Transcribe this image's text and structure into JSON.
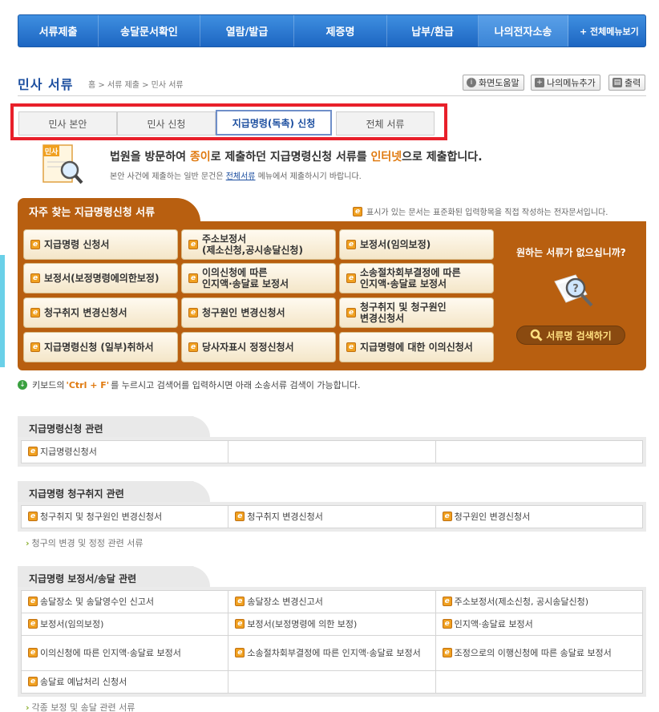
{
  "nav": {
    "items": [
      "서류제출",
      "송달문서확인",
      "열람/발급",
      "제증명",
      "납부/환급",
      "나의전자소송"
    ],
    "active": "나의전자소송",
    "all_menu": "+ 전체메뉴보기"
  },
  "header": {
    "title": "민사 서류",
    "breadcrumb": "홈 > 서류 제출 > 민사 서류",
    "help": "화면도움말",
    "add_menu": "나의메뉴추가",
    "print": "출력"
  },
  "tabs": [
    "민사 본안",
    "민사 신청",
    "지급명령(독촉) 신청",
    "전체 서류"
  ],
  "intro": {
    "head_1": "법원을 방문하여 ",
    "head_hl1": "종이",
    "head_2": "로 제출하던 지급명령신청 서류를 ",
    "head_hl2": "인터넷",
    "head_3": "으로 제출합니다.",
    "sub_1": "본안 사건에 제출하는 일반 문건은 ",
    "sub_link": "전체서류",
    "sub_2": " 메뉴에서 제출하시기 바랍니다.",
    "icon_label": "민사"
  },
  "frequent": {
    "title": "자주 찾는 지급명령신청 서류",
    "note": "표시가 있는 문서는 표준화된 입력항목을 직접 작성하는 전자문서입니다.",
    "docs": [
      [
        "지급명령 신청서",
        "주소보정서\n(제소신청,공시송달신청)",
        "보정서(임의보정)"
      ],
      [
        "보정서(보정명령에의한보정)",
        "이의신청에 따른\n인지액·송달료 보정서",
        "소송절차회부결정에 따른\n인지액·송달료 보정서"
      ],
      [
        "청구취지 변경신청서",
        "청구원인 변경신청서",
        "청구취지 및 청구원인\n변경신청서"
      ],
      [
        "지급명령신청 (일부)취하서",
        "당사자표시 정정신청서",
        "지급명령에 대한 이의신청서"
      ]
    ],
    "missing_title": "원하는 서류가 없으십니까?",
    "search_label": "서류명 검색하기"
  },
  "kbd_hint": {
    "pre": "키보드의 ",
    "key": "'Ctrl + F'",
    "post": "를 누르시고 검색어를 입력하시면 아래 소송서류 검색이 가능합니다."
  },
  "sections": [
    {
      "title": "지급명령신청 관련",
      "rows": [
        [
          "지급명령신청서",
          "",
          ""
        ]
      ]
    },
    {
      "title": "지급명령 청구취지 관련",
      "rows": [
        [
          "청구취지 및 청구원인 변경신청서",
          "청구취지 변경신청서",
          "청구원인 변경신청서"
        ]
      ],
      "related": "청구의 변경 및 정정 관련 서류"
    },
    {
      "title": "지급명령 보정서/송달 관련",
      "rows": [
        [
          "송달장소 및 송달영수인 신고서",
          "송달장소 변경신고서",
          "주소보정서(제소신청, 공시송달신청)"
        ],
        [
          "보정서(임의보정)",
          "보정서(보정명령에 의한 보정)",
          "인지액·송달료 보정서"
        ],
        [
          "이의신청에 따른 인지액·송달료 보정서",
          "소송절차회부결정에 따른 인지액·송달료 보정서",
          "조정으로의 이행신청에 따른 송달료 보정서"
        ],
        [
          "송달료 예납처리 신청서",
          "",
          ""
        ]
      ],
      "related": "각종 보정 및 송달 관련 서류"
    }
  ],
  "colors": {
    "nav": "#1d66c2",
    "panel": "#b85f10",
    "highlight": "#e8202a",
    "accent": "#e07a10"
  }
}
